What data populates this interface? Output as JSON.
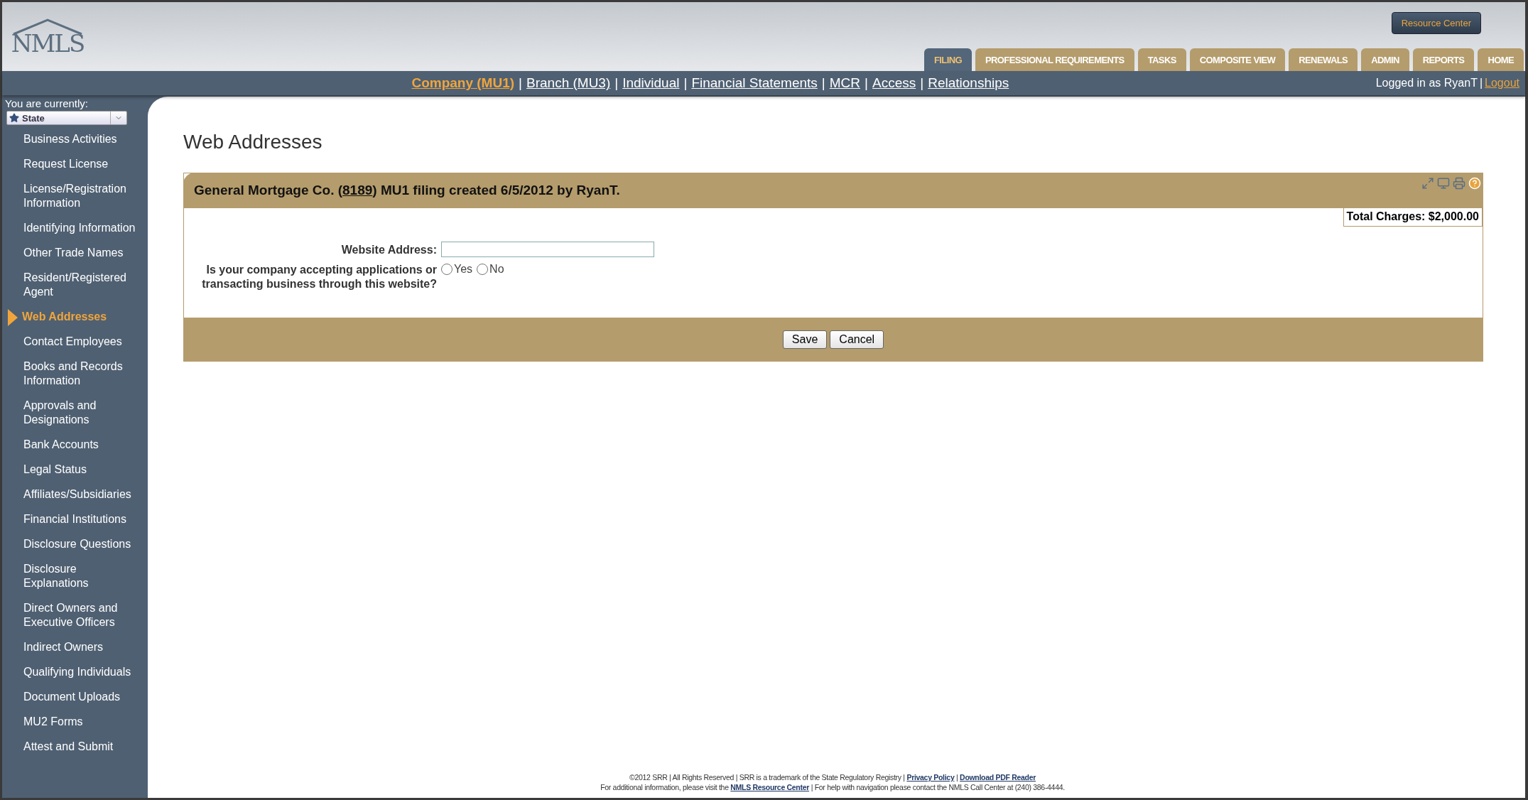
{
  "logo": {
    "text": "NMLS"
  },
  "resource_button": "Resource Center",
  "tabs": [
    {
      "label": "FILING",
      "selected": true
    },
    {
      "label": "PROFESSIONAL REQUIREMENTS",
      "selected": false
    },
    {
      "label": "TASKS",
      "selected": false
    },
    {
      "label": "COMPOSITE VIEW",
      "selected": false
    },
    {
      "label": "RENEWALS",
      "selected": false
    },
    {
      "label": "ADMIN",
      "selected": false
    },
    {
      "label": "REPORTS",
      "selected": false
    },
    {
      "label": "HOME",
      "selected": false
    }
  ],
  "filing_links": {
    "separator": "|",
    "items": [
      {
        "label": "Company (MU1)",
        "selected": true
      },
      {
        "label": "Branch (MU3)",
        "selected": false
      },
      {
        "label": "Individual",
        "selected": false
      },
      {
        "label": "Financial Statements",
        "selected": false
      },
      {
        "label": "MCR",
        "selected": false
      },
      {
        "label": "Access",
        "selected": false
      },
      {
        "label": "Relationships",
        "selected": false
      }
    ]
  },
  "user": {
    "text": "Logged in as RyanT",
    "separator": "|",
    "logout": "Logout"
  },
  "sidebar": {
    "caption": "You are currently:",
    "role": "State",
    "items": [
      {
        "label": "Business Activities",
        "selected": false
      },
      {
        "label": "Request License",
        "selected": false
      },
      {
        "label": "License/Registration Information",
        "selected": false
      },
      {
        "label": "Identifying Information",
        "selected": false
      },
      {
        "label": "Other Trade Names",
        "selected": false
      },
      {
        "label": "Resident/Registered Agent",
        "selected": false
      },
      {
        "label": "Web Addresses",
        "selected": true
      },
      {
        "label": "Contact Employees",
        "selected": false
      },
      {
        "label": "Books and Records Information",
        "selected": false
      },
      {
        "label": "Approvals and Designations",
        "selected": false
      },
      {
        "label": "Bank Accounts",
        "selected": false
      },
      {
        "label": "Legal Status",
        "selected": false
      },
      {
        "label": "Affiliates/Subsidiaries",
        "selected": false
      },
      {
        "label": "Financial Institutions",
        "selected": false
      },
      {
        "label": "Disclosure Questions",
        "selected": false
      },
      {
        "label": "Disclosure Explanations",
        "selected": false
      },
      {
        "label": "Direct Owners and Executive Officers",
        "selected": false
      },
      {
        "label": "Indirect Owners",
        "selected": false
      },
      {
        "label": "Qualifying Individuals",
        "selected": false
      },
      {
        "label": "Document Uploads",
        "selected": false
      },
      {
        "label": "MU2 Forms",
        "selected": false
      },
      {
        "label": "Attest and Submit",
        "selected": false
      }
    ]
  },
  "page_title": "Web Addresses",
  "card": {
    "title_before": "General Mortgage Co. (",
    "title_link": "8189",
    "title_after": ") MU1 filing created 6/5/2012 by RyanT.",
    "total_charges": "Total Charges: $2,000.00",
    "fields": [
      {
        "kind": "text",
        "label": "Website Address:"
      },
      {
        "kind": "radio",
        "label": "Is your company accepting applications or transacting business through this website?",
        "options": [
          {
            "label": "Yes",
            "selected": false
          },
          {
            "label": "No",
            "selected": false
          }
        ]
      }
    ],
    "buttons": [
      "Save",
      "Cancel"
    ]
  },
  "footer": {
    "lines": [
      [
        {
          "text": "©2012 SRR | All Rights Reserved | SRR is a trademark of the State Regulatory Registry | ",
          "link": false
        },
        {
          "text": "Privacy Policy",
          "link": true
        },
        {
          "text": " | ",
          "link": false
        },
        {
          "text": "Download PDF Reader",
          "link": true
        }
      ],
      [
        {
          "text": "For additional information, please visit the ",
          "link": false
        },
        {
          "text": "NMLS Resource Center",
          "link": true
        },
        {
          "text": " | For help with navigation please contact the NMLS Call Center at (240) 386-4444.",
          "link": false
        }
      ]
    ]
  }
}
